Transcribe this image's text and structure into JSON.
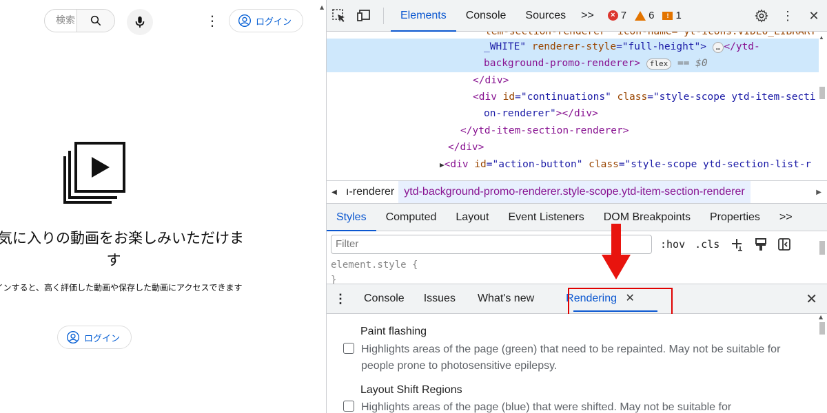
{
  "youtube": {
    "search_placeholder": "検索",
    "login_label": "ログイン",
    "empty_title": "お気に入りの動画をお楽しみいただけます",
    "empty_description": "ログインすると、高く評価した動画や保存した動画にアクセスできます"
  },
  "devtools": {
    "tabs": [
      "Elements",
      "Console",
      "Sources"
    ],
    "more_tabs": ">>",
    "errors": "7",
    "warnings": "6",
    "issues": "1",
    "tree": {
      "l1a": "tem-section-renderer\" icon-name=\"yt-icons:VIDEO_LIBRARY",
      "l2a": "_WHITE\"",
      "l2b": "renderer-style",
      "l2c": "=\"full-height\">",
      "l2d": "</ytd-",
      "l3a": "background-promo-renderer>",
      "l3_pill": "flex",
      "l3_sel": "== $0",
      "l4": "</div>",
      "l5a": "<div ",
      "l5b": "id",
      "l5c": "=\"continuations\" ",
      "l5d": "class",
      "l5e": "=\"style-scope ytd-item-secti",
      "l6a": "on-renderer\"",
      "l6b": "></div>",
      "l7": "</ytd-item-section-renderer>",
      "l8": "</div>",
      "l9a": "<div ",
      "l9b": "id",
      "l9c": "=\"action-button\" ",
      "l9d": "class",
      "l9e": "=\"style-scope ytd-section-list-r"
    },
    "breadcrumb": {
      "prev": "ı-renderer",
      "current": "ytd-background-promo-renderer.style-scope.ytd-item-section-renderer"
    },
    "style_tabs": [
      "Styles",
      "Computed",
      "Layout",
      "Event Listeners",
      "DOM Breakpoints",
      "Properties"
    ],
    "style_more": ">>",
    "filter_placeholder": "Filter",
    "hov": ":hov",
    "cls": ".cls",
    "element_style_1": "element.style {",
    "element_style_2": "}",
    "drawer_tabs": [
      "Console",
      "Issues",
      "What's new"
    ],
    "drawer_active": "Rendering",
    "rendering_options": [
      {
        "title": "Paint flashing",
        "desc": "Highlights areas of the page (green) that need to be repainted. May not be suitable for people prone to photosensitive epilepsy."
      },
      {
        "title": "Layout Shift Regions",
        "desc": "Highlights areas of the page (blue) that were shifted. May not be suitable for"
      }
    ]
  },
  "colors": {
    "accent": "#0b57d0",
    "highlight_red": "#e00000",
    "youtube_link": "#065fd4"
  }
}
